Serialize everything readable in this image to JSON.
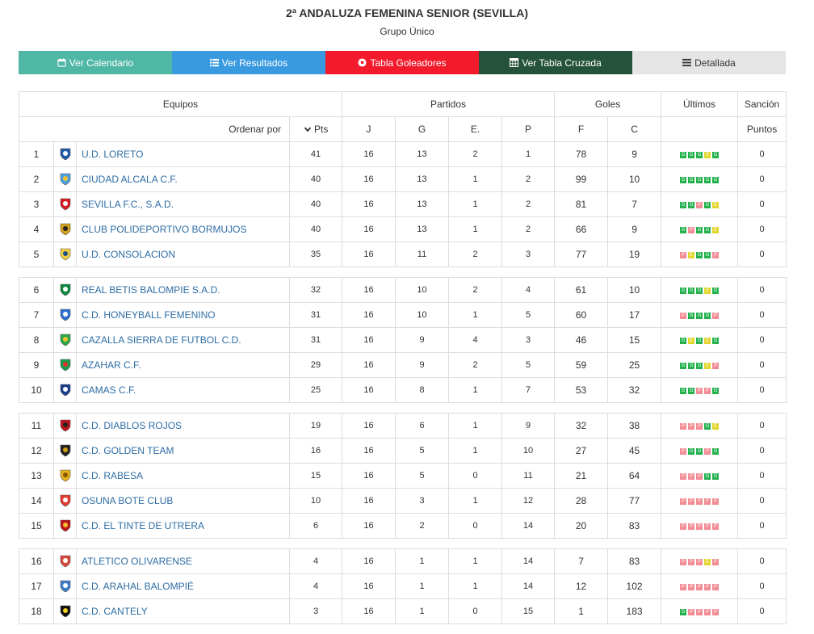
{
  "page": {
    "title": "2ª ANDALUZA FEMENINA SENIOR (SEVILLA)",
    "subtitle": "Grupo Único"
  },
  "nav": [
    {
      "label": "Ver Calendario",
      "icon": "calendar-icon"
    },
    {
      "label": "Ver Resultados",
      "icon": "list-icon"
    },
    {
      "label": "Tabla Goleadores",
      "icon": "football-icon"
    },
    {
      "label": "Ver Tabla Cruzada",
      "icon": "table-icon"
    },
    {
      "label": "Detallada",
      "icon": "list-detail-icon"
    }
  ],
  "headers": {
    "equipos": "Equipos",
    "partidos": "Partidos",
    "goles": "Goles",
    "ultimos": "Últimos",
    "sancion": "Sanción",
    "ordenar": "Ordenar por",
    "pts": "Pts",
    "j": "J",
    "g": "G",
    "e": "E.",
    "p": "P",
    "f": "F",
    "c": "C",
    "puntos": "Puntos"
  },
  "colors": {
    "win": "#22b14c",
    "draw": "#e3d52d",
    "loss": "#f28b93",
    "link": "#2e6da4"
  },
  "groups": [
    [
      {
        "pos": "1",
        "team": "U.D. LORETO",
        "pts": "41",
        "j": "16",
        "g": "13",
        "e": "2",
        "p": "1",
        "f": "78",
        "c": "9",
        "last": [
          "G",
          "G",
          "G",
          "E",
          "G"
        ],
        "s": "0",
        "logo": [
          "#1e5aa8",
          "#ffffff"
        ]
      },
      {
        "pos": "2",
        "team": "CIUDAD ALCALA C.F.",
        "pts": "40",
        "j": "16",
        "g": "13",
        "e": "1",
        "p": "2",
        "f": "99",
        "c": "10",
        "last": [
          "G",
          "G",
          "G",
          "G",
          "G"
        ],
        "s": "0",
        "logo": [
          "#4aa3df",
          "#f2c230"
        ]
      },
      {
        "pos": "3",
        "team": "SEVILLA F.C., S.A.D.",
        "pts": "40",
        "j": "16",
        "g": "13",
        "e": "1",
        "p": "2",
        "f": "81",
        "c": "7",
        "last": [
          "G",
          "G",
          "P",
          "G",
          "E"
        ],
        "s": "0",
        "logo": [
          "#d71920",
          "#ffffff"
        ]
      },
      {
        "pos": "4",
        "team": "CLUB POLIDEPORTIVO BORMUJOS",
        "pts": "40",
        "j": "16",
        "g": "13",
        "e": "1",
        "p": "2",
        "f": "66",
        "c": "9",
        "last": [
          "G",
          "P",
          "G",
          "G",
          "E"
        ],
        "s": "0",
        "logo": [
          "#d4a017",
          "#222222"
        ]
      },
      {
        "pos": "5",
        "team": "U.D. CONSOLACION",
        "pts": "35",
        "j": "16",
        "g": "11",
        "e": "2",
        "p": "3",
        "f": "77",
        "c": "19",
        "last": [
          "P",
          "E",
          "G",
          "G",
          "P"
        ],
        "s": "0",
        "logo": [
          "#f4d03f",
          "#1b4f8a"
        ]
      }
    ],
    [
      {
        "pos": "6",
        "team": "REAL BETIS BALOMPIE S.A.D.",
        "pts": "32",
        "j": "16",
        "g": "10",
        "e": "2",
        "p": "4",
        "f": "61",
        "c": "10",
        "last": [
          "G",
          "G",
          "G",
          "E",
          "G"
        ],
        "s": "0",
        "logo": [
          "#0b8a3e",
          "#ffffff"
        ]
      },
      {
        "pos": "7",
        "team": "C.D. HONEYBALL FEMENINO",
        "pts": "31",
        "j": "16",
        "g": "10",
        "e": "1",
        "p": "5",
        "f": "60",
        "c": "17",
        "last": [
          "P",
          "G",
          "G",
          "G",
          "P"
        ],
        "s": "0",
        "logo": [
          "#2f6fd1",
          "#ffffff"
        ]
      },
      {
        "pos": "8",
        "team": "CAZALLA SIERRA DE FUTBOL C.D.",
        "pts": "31",
        "j": "16",
        "g": "9",
        "e": "4",
        "p": "3",
        "f": "46",
        "c": "15",
        "last": [
          "G",
          "E",
          "G",
          "E",
          "G"
        ],
        "s": "0",
        "logo": [
          "#2aa84a",
          "#f2c230"
        ]
      },
      {
        "pos": "9",
        "team": "AZAHAR C.F.",
        "pts": "29",
        "j": "16",
        "g": "9",
        "e": "2",
        "p": "5",
        "f": "59",
        "c": "25",
        "last": [
          "G",
          "G",
          "G",
          "E",
          "P"
        ],
        "s": "0",
        "logo": [
          "#1a9e4b",
          "#e03030"
        ]
      },
      {
        "pos": "10",
        "team": "CAMAS C.F.",
        "pts": "25",
        "j": "16",
        "g": "8",
        "e": "1",
        "p": "7",
        "f": "53",
        "c": "32",
        "last": [
          "G",
          "G",
          "P",
          "P",
          "G"
        ],
        "s": "0",
        "logo": [
          "#1d3f8f",
          "#ffffff"
        ]
      }
    ],
    [
      {
        "pos": "11",
        "team": "C.D. DIABLOS ROJOS",
        "pts": "19",
        "j": "16",
        "g": "6",
        "e": "1",
        "p": "9",
        "f": "32",
        "c": "38",
        "last": [
          "P",
          "P",
          "P",
          "G",
          "E"
        ],
        "s": "0",
        "logo": [
          "#c0121c",
          "#222222"
        ]
      },
      {
        "pos": "12",
        "team": "C.D. GOLDEN TEAM",
        "pts": "16",
        "j": "16",
        "g": "5",
        "e": "1",
        "p": "10",
        "f": "27",
        "c": "45",
        "last": [
          "P",
          "G",
          "G",
          "P",
          "G"
        ],
        "s": "0",
        "logo": [
          "#222222",
          "#d4a017"
        ]
      },
      {
        "pos": "13",
        "team": "C.D. RABESA",
        "pts": "15",
        "j": "16",
        "g": "5",
        "e": "0",
        "p": "11",
        "f": "21",
        "c": "64",
        "last": [
          "P",
          "P",
          "P",
          "G",
          "G"
        ],
        "s": "0",
        "logo": [
          "#e8b21c",
          "#8a5a00"
        ]
      },
      {
        "pos": "14",
        "team": "OSUNA BOTE CLUB",
        "pts": "10",
        "j": "16",
        "g": "3",
        "e": "1",
        "p": "12",
        "f": "28",
        "c": "77",
        "last": [
          "P",
          "P",
          "P",
          "P",
          "P"
        ],
        "s": "0",
        "logo": [
          "#e33b2e",
          "#ffffff"
        ]
      },
      {
        "pos": "15",
        "team": "C.D. EL TINTE DE UTRERA",
        "pts": "6",
        "j": "16",
        "g": "2",
        "e": "0",
        "p": "14",
        "f": "20",
        "c": "83",
        "last": [
          "P",
          "P",
          "P",
          "P",
          "P"
        ],
        "s": "0",
        "logo": [
          "#c0121c",
          "#f2c230"
        ]
      }
    ],
    [
      {
        "pos": "16",
        "team": "ATLETICO OLIVARENSE",
        "pts": "4",
        "j": "16",
        "g": "1",
        "e": "1",
        "p": "14",
        "f": "7",
        "c": "83",
        "last": [
          "P",
          "P",
          "P",
          "E",
          "P"
        ],
        "s": "0",
        "logo": [
          "#d94a3a",
          "#ffffff"
        ]
      },
      {
        "pos": "17",
        "team": "C.D. ARAHAL BALOMPIÉ",
        "pts": "4",
        "j": "16",
        "g": "1",
        "e": "1",
        "p": "14",
        "f": "12",
        "c": "102",
        "last": [
          "P",
          "P",
          "P",
          "P",
          "P"
        ],
        "s": "0",
        "logo": [
          "#3d7cc9",
          "#ffffff"
        ]
      },
      {
        "pos": "18",
        "team": "C.D. CANTELY",
        "pts": "3",
        "j": "16",
        "g": "1",
        "e": "0",
        "p": "15",
        "f": "1",
        "c": "183",
        "last": [
          "G",
          "P",
          "P",
          "P",
          "P"
        ],
        "s": "0",
        "logo": [
          "#111111",
          "#f2d21c"
        ]
      }
    ]
  ]
}
